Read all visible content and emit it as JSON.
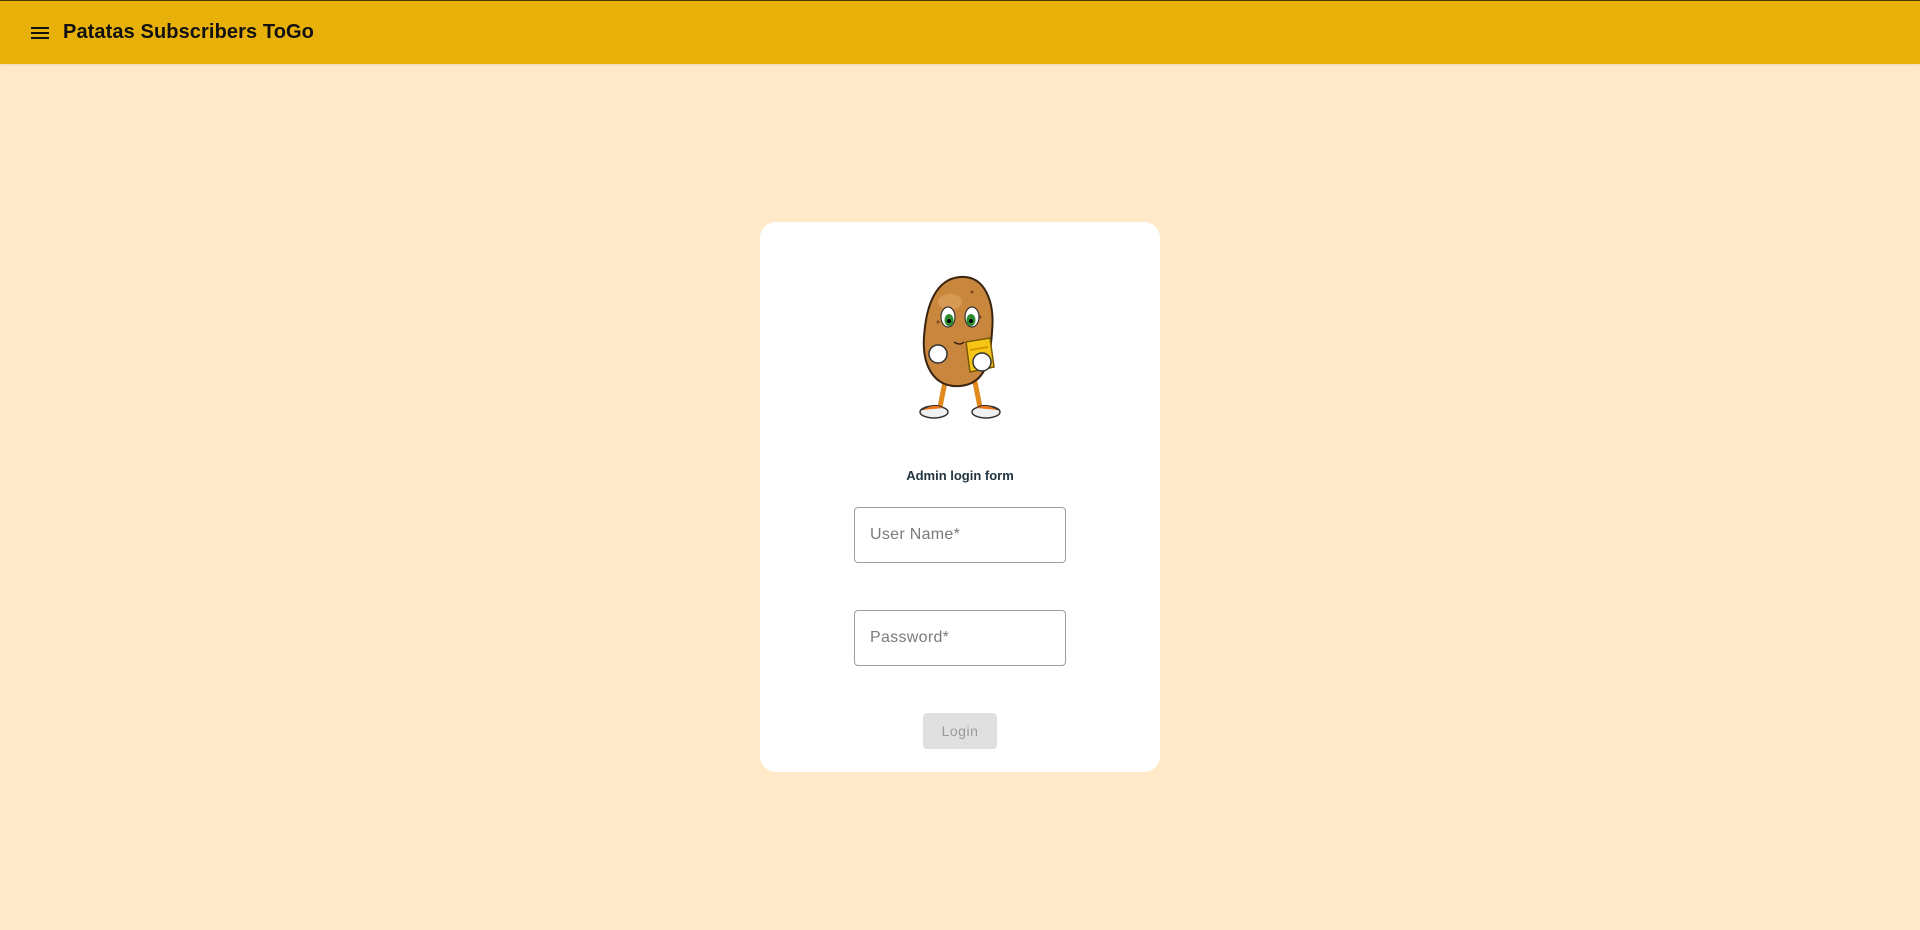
{
  "toolbar": {
    "title": "Patatas Subscribers ToGo",
    "menu_icon": "menu-icon",
    "background_color": "#E8B10A"
  },
  "page": {
    "background_color": "#FFE9C8"
  },
  "login_card": {
    "mascot_icon": "potato-mascot",
    "form_title": "Admin login form",
    "username": {
      "placeholder": "User Name*",
      "value": ""
    },
    "password": {
      "placeholder": "Password*",
      "value": ""
    },
    "login_label": "Login",
    "login_enabled": false
  }
}
